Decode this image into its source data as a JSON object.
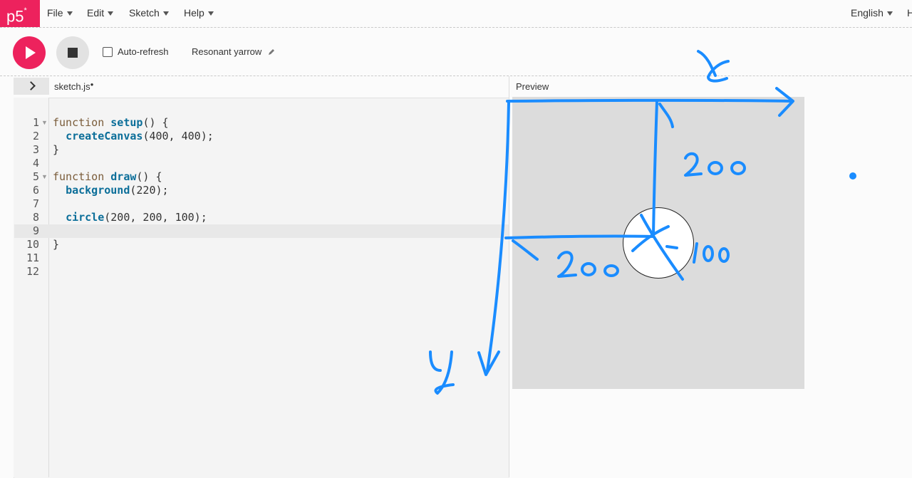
{
  "nav": {
    "logo": "p5",
    "logo_sup": "*",
    "menus": [
      {
        "label": "File"
      },
      {
        "label": "Edit"
      },
      {
        "label": "Sketch"
      },
      {
        "label": "Help"
      }
    ],
    "language": "English",
    "right_cut": "H"
  },
  "toolbar": {
    "play_label": "",
    "stop_label": "",
    "auto_refresh": "Auto-refresh",
    "auto_refresh_checked": false,
    "sketch_name": "Resonant yarrow"
  },
  "editor": {
    "file_tab": "sketch.js",
    "unsaved_dot": "●",
    "line_numbers": [
      "1",
      "2",
      "3",
      "4",
      "5",
      "6",
      "7",
      "8",
      "9",
      "10",
      "11",
      "12"
    ],
    "active_line": 9
  },
  "preview": {
    "label": "Preview",
    "canvas_background": "#dcdcdc",
    "circle_fill": "#ffffff"
  },
  "annotations": {
    "ink_color": "#1a8cff",
    "x_label": "x",
    "y_label": "y",
    "top_distance": "200",
    "left_distance": "200",
    "diameter": "100"
  },
  "colors": {
    "brand": "#ed225d",
    "stop_button": "#e2e2e2"
  }
}
